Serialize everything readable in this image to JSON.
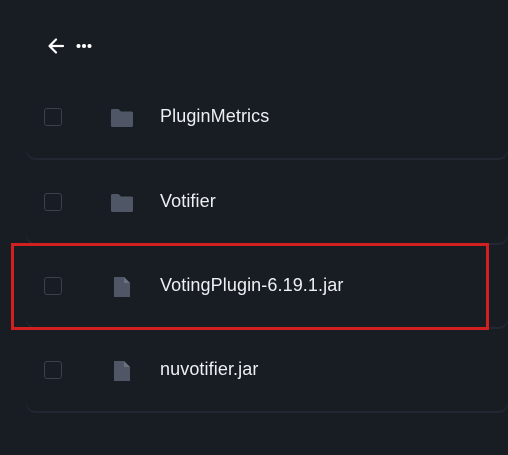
{
  "toolbar": {
    "back_icon": "arrow-left-icon",
    "more_icon": "more-horizontal-icon"
  },
  "files": [
    {
      "name": "PluginMetrics",
      "type": "folder",
      "icon": "folder-icon"
    },
    {
      "name": "Votifier",
      "type": "folder",
      "icon": "folder-icon"
    },
    {
      "name": "VotingPlugin-6.19.1.jar",
      "type": "file",
      "icon": "file-icon"
    },
    {
      "name": "nuvotifier.jar",
      "type": "file",
      "icon": "file-icon"
    }
  ],
  "colors": {
    "background": "#181c23",
    "text": "#eef0f3",
    "icon": "#4f5767",
    "highlight": "#d21f1f"
  }
}
